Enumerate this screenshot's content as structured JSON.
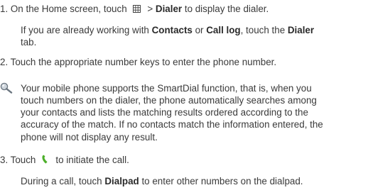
{
  "steps": [
    {
      "line1_pre": "1. On the Home screen, touch",
      "line1_gt": " > ",
      "line1_bold": "Dialer",
      "line1_post": " to display the dialer.",
      "sub_pre": "If you are already working with ",
      "sub_b1": "Contacts",
      "sub_mid1": " or ",
      "sub_b2": "Call log",
      "sub_mid2": ", touch the ",
      "sub_b3": "Dialer",
      "sub_cont": "tab."
    },
    {
      "text": "2. Touch the appropriate number keys to enter the phone number."
    },
    {
      "pre": "3. Touch",
      "post": "to initiate the call.",
      "sub_pre": "During a call, touch ",
      "sub_bold": "Dialpad",
      "sub_post": " to enter other numbers on the dialpad."
    }
  ],
  "tip": {
    "lines": [
      "Your mobile phone supports the SmartDial function, that is, when you",
      "touch numbers on the dialer, the phone automatically searches among",
      "your contacts and lists the matching results ordered according to the",
      "accuracy of the match. If no contacts match the information entered, the",
      "phone will not display any result."
    ]
  },
  "icons": {
    "grid": "app-grid-icon",
    "tip": "tip-magnifier-icon",
    "call": "green-phone-icon"
  },
  "colors": {
    "text": "#3a3a3a",
    "call_icon": "#4caf2a"
  }
}
